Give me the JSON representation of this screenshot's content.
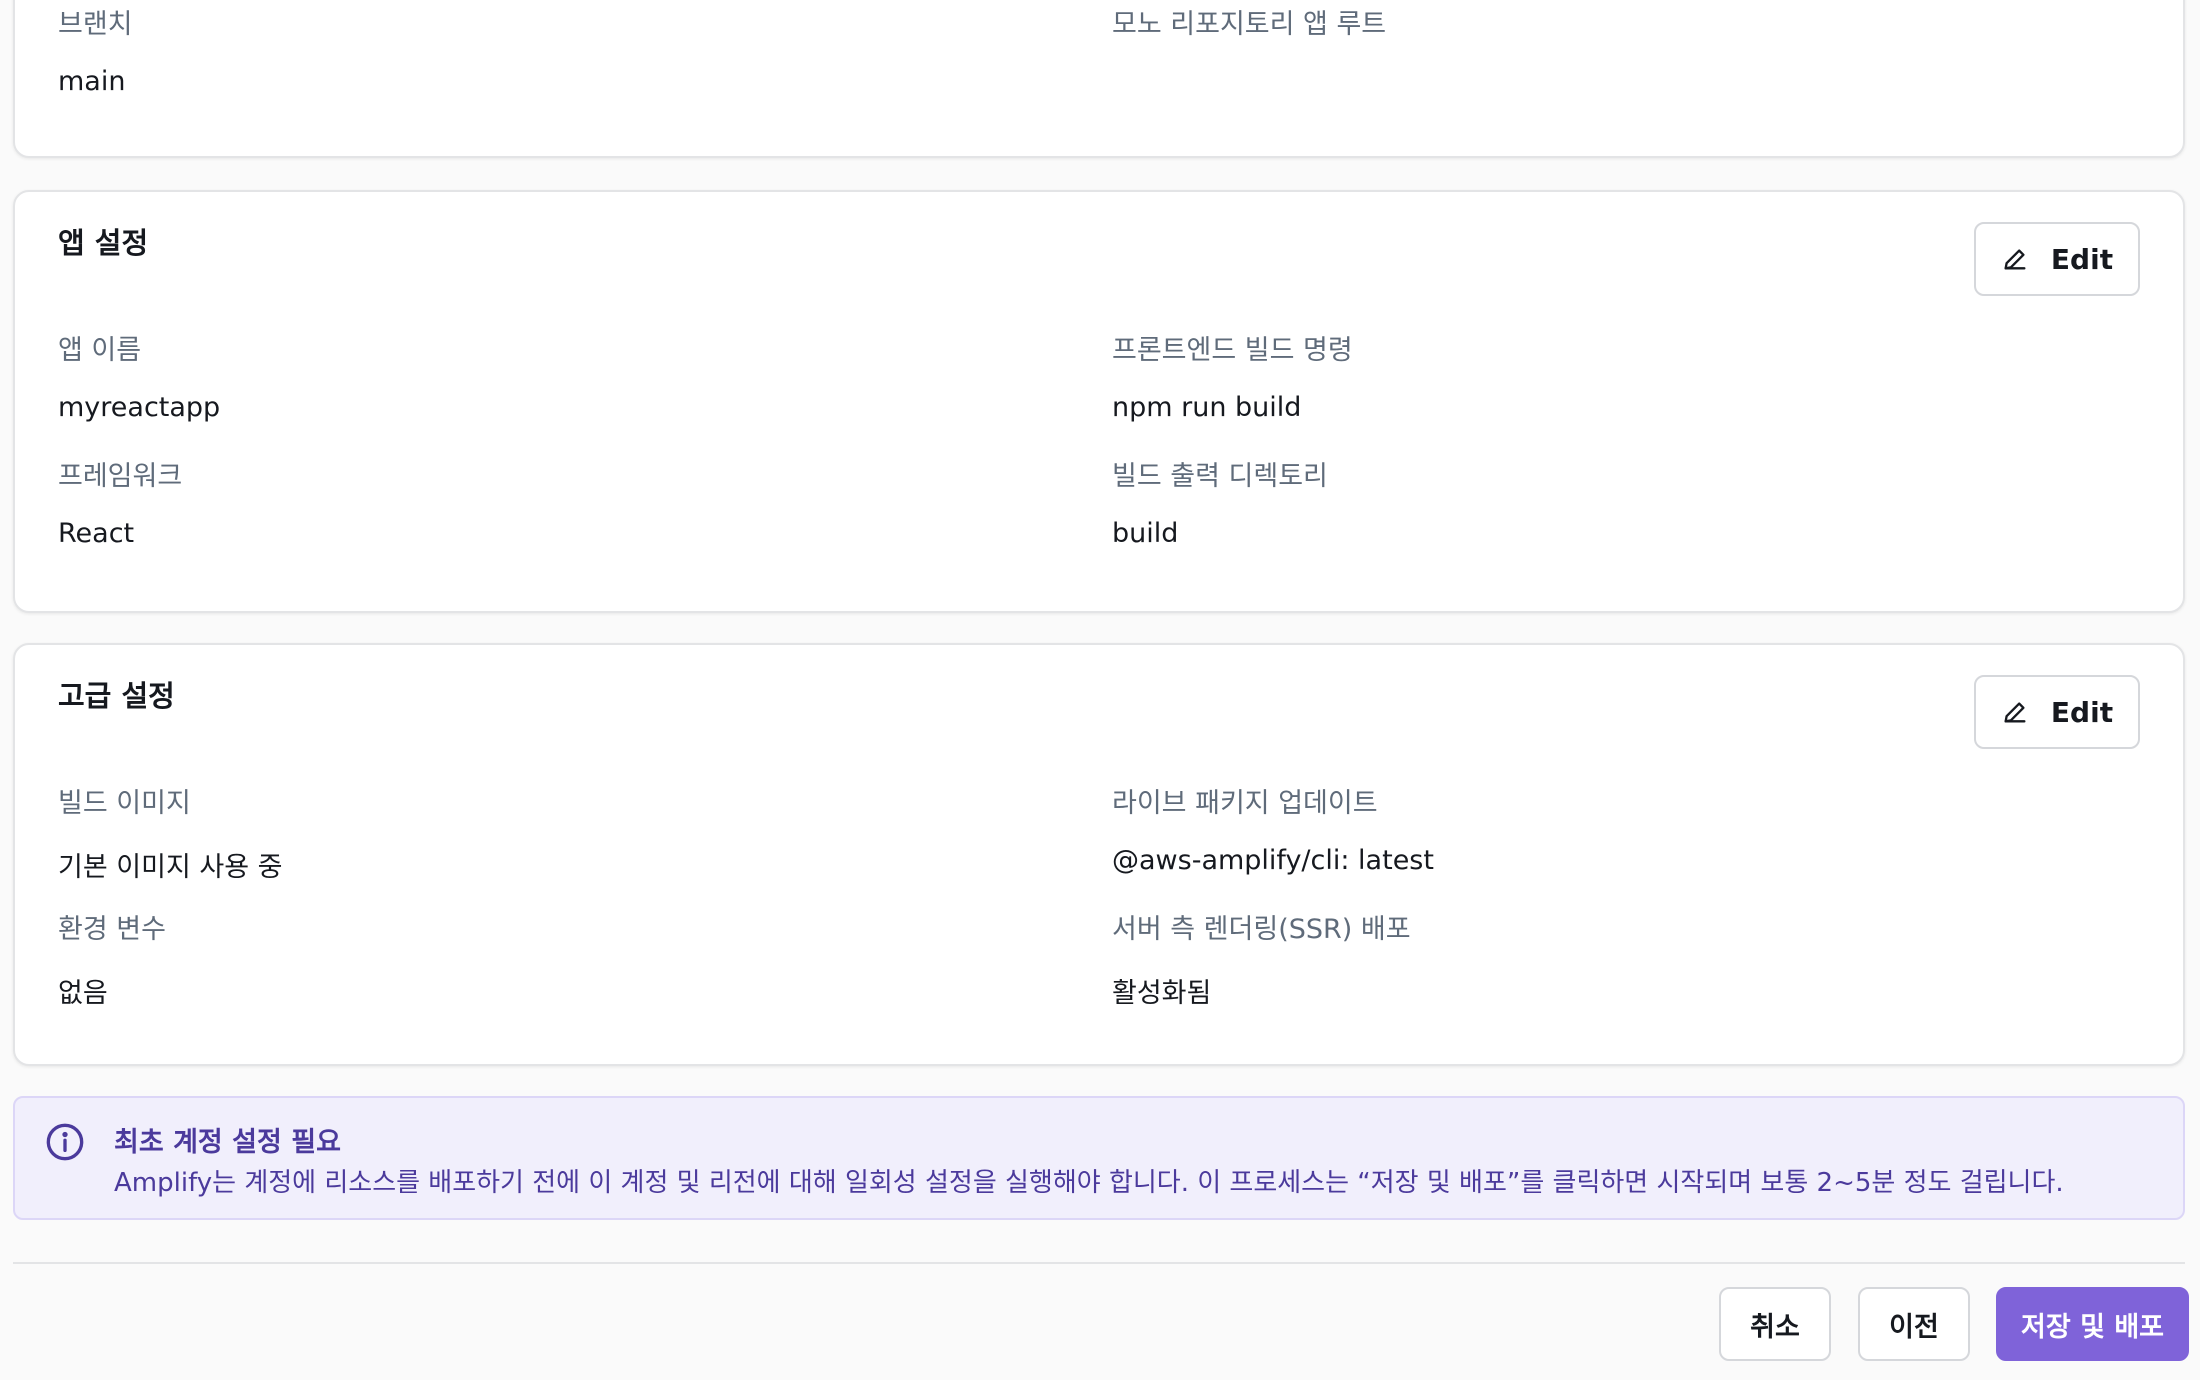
{
  "repository_card": {
    "branch_label": "브랜치",
    "branch_value": "main",
    "monorepo_label": "모노 리포지토리 앱 루트"
  },
  "app_settings": {
    "title": "앱 설정",
    "edit_label": "Edit",
    "app_name_label": "앱 이름",
    "app_name_value": "myreactapp",
    "build_command_label": "프론트엔드 빌드 명령",
    "build_command_value": "npm run build",
    "framework_label": "프레임워크",
    "framework_value": "React",
    "output_dir_label": "빌드 출력 디렉토리",
    "output_dir_value": "build"
  },
  "advanced_settings": {
    "title": "고급 설정",
    "edit_label": "Edit",
    "build_image_label": "빌드 이미지",
    "build_image_value": "기본 이미지 사용 중",
    "live_package_label": "라이브 패키지 업데이트",
    "live_package_value": "@aws-amplify/cli: latest",
    "env_vars_label": "환경 변수",
    "env_vars_value": "없음",
    "ssr_label": "서버 측 렌더링(SSR) 배포",
    "ssr_value": "활성화됨"
  },
  "alert": {
    "icon": "info-icon",
    "title": "최초 계정 설정 필요",
    "body": "Amplify는 계정에 리소스를 배포하기 전에 이 계정 및 리전에 대해 일회성 설정을 실행해야 합니다. 이 프로세스는 “저장 및 배포”를 클릭하면 시작되며 보통 2~5분 정도 걸립니다."
  },
  "footer": {
    "cancel_label": "취소",
    "previous_label": "이전",
    "save_deploy_label": "저장 및 배포"
  },
  "colors": {
    "primary": "#7f63d9",
    "alert_background": "#f1effc",
    "alert_text": "#4b3a9c",
    "label_text": "#5f6b7a"
  }
}
